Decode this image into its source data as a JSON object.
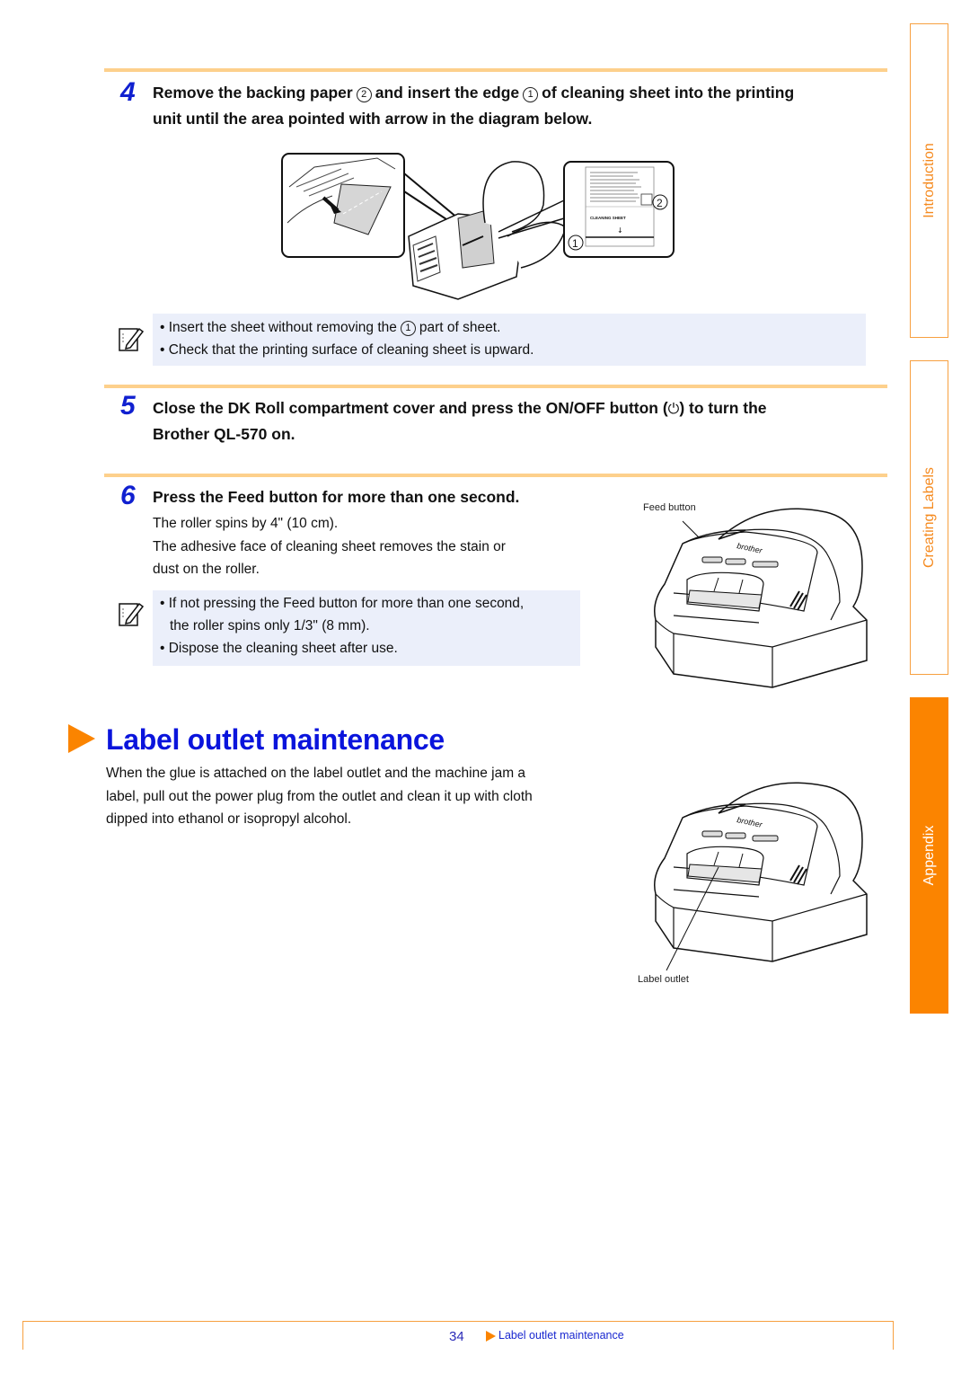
{
  "side_tabs": [
    {
      "label": "Introduction",
      "active": false
    },
    {
      "label": "Creating Labels",
      "active": false
    },
    {
      "label": "Appendix",
      "active": true
    }
  ],
  "steps": {
    "step4": {
      "number": "4",
      "line1_a": "Remove the backing paper",
      "circle_a": "2",
      "line1_b": "and insert the edge",
      "circle_b": "1",
      "line1_c": "of cleaning sheet into the printing",
      "line2": "unit until the area pointed with arrow in the diagram below."
    },
    "step5": {
      "number": "5",
      "line1_a": "Close the DK Roll compartment cover and press the ON/OFF button (",
      "line1_b": ") to turn the",
      "line2": "Brother QL-570 on."
    },
    "step6": {
      "number": "6",
      "title": "Press the Feed button for more than one second.",
      "body1": "The roller spins by 4\" (10 cm).",
      "body2": "The adhesive face of cleaning sheet removes the stain or",
      "body3": "dust on the roller."
    }
  },
  "notes": {
    "note1": {
      "bullet1_a": "• Insert the sheet without removing the",
      "bullet1_circle": "1",
      "bullet1_b": "part of sheet.",
      "bullet2": "• Check that the printing surface of cleaning sheet is upward."
    },
    "note2": {
      "bullet1_line1": "• If not pressing the Feed button for more than one second,",
      "bullet1_line2": "the roller spins only 1/3\" (8 mm).",
      "bullet2": "• Dispose the cleaning sheet after use."
    }
  },
  "figures": {
    "cleaning_sheet_label": "CLEANING SHEET",
    "circle_1": "1",
    "circle_2": "2",
    "brand": "brother",
    "feed_button_caption": "Feed button",
    "label_outlet_caption": "Label outlet"
  },
  "section": {
    "heading": "Label outlet maintenance",
    "para1": "When the glue is attached on the label outlet and the machine jam a",
    "para2": "label, pull out the power plug from the outlet and clean it up with cloth",
    "para3": "dipped into ethanol or isopropyl alcohol."
  },
  "footer": {
    "page_number": "34",
    "link": "Label outlet maintenance"
  },
  "colors": {
    "accent_orange": "#fb8400",
    "heading_blue": "#0a14dc",
    "rule": "#fdd08c",
    "note_bg": "#ebeffa"
  }
}
